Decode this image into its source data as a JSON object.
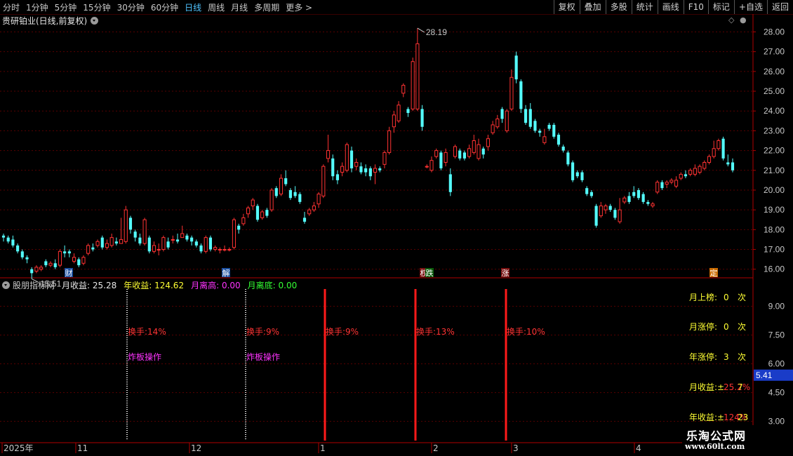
{
  "toolbar": {
    "periods": [
      "分时",
      "1分钟",
      "5分钟",
      "15分钟",
      "30分钟",
      "60分钟",
      "日线",
      "周线",
      "月线",
      "多周期",
      "更多 >"
    ],
    "active_period": "日线",
    "buttons": [
      "复权",
      "叠加",
      "多股",
      "统计",
      "画线",
      "F10",
      "标记",
      "+自选",
      "返回"
    ]
  },
  "chart_header": {
    "title": "贵研铂业(日线,前复权)"
  },
  "price_axis": {
    "labels": [
      "28.00",
      "27.00",
      "26.00",
      "25.00",
      "24.00",
      "23.00",
      "22.00",
      "21.00",
      "20.00",
      "19.00",
      "18.00",
      "17.00",
      "16.00"
    ],
    "min": 15.6,
    "max": 28.3
  },
  "annotations": {
    "high": "28.19",
    "low": "15.51"
  },
  "event_markers": [
    {
      "label": "财",
      "bg": "#1a4fa0",
      "fg": "#ffffff"
    },
    {
      "label": "解",
      "bg": "#1a4fa0",
      "fg": "#ffffff"
    },
    {
      "label": "权",
      "bg": "#7a1010",
      "fg": "#ffffff"
    },
    {
      "label": "跌",
      "bg": "#0a5a0a",
      "fg": "#ffffff"
    },
    {
      "label": "涨",
      "bg": "#7a1010",
      "fg": "#ffffff"
    },
    {
      "label": "定",
      "bg": "#c86a00",
      "fg": "#ffffff"
    }
  ],
  "indicator": {
    "name": "股朋指标网",
    "values": [
      {
        "label": "月收益: 25.28",
        "color": "#e8e8e8"
      },
      {
        "label": "年收益: 124.62",
        "color": "#ffff33"
      },
      {
        "label": "月离高: 0.00",
        "color": "#ff33ff"
      },
      {
        "label": "月离底: 0.00",
        "color": "#33ff33"
      }
    ],
    "axis_labels": [
      "9.00",
      "7.50",
      "6.00",
      "4.50",
      "3.00"
    ],
    "current_value": "5.41",
    "vlines": [
      {
        "type": "dotted",
        "texts": [
          {
            "t": "换手:14%",
            "c": "#ff3333"
          },
          {
            "t": "炸板操作",
            "c": "#ff33ff"
          }
        ]
      },
      {
        "type": "dotted",
        "texts": [
          {
            "t": "换手:9%",
            "c": "#ff3333"
          },
          {
            "t": "炸板操作",
            "c": "#ff33ff"
          }
        ]
      },
      {
        "type": "solid",
        "texts": [
          {
            "t": "换手:9%",
            "c": "#ff3333"
          }
        ]
      },
      {
        "type": "solid",
        "texts": [
          {
            "t": "换手:13%",
            "c": "#ff3333"
          }
        ]
      },
      {
        "type": "solid",
        "texts": [
          {
            "t": "换手:10%",
            "c": "#ff3333"
          }
        ]
      }
    ],
    "stats": [
      {
        "label": "月上榜:",
        "value": "0",
        "unit": "次"
      },
      {
        "label": "月涨停:",
        "value": "0",
        "unit": "次"
      },
      {
        "label": "年涨停:",
        "value": "3",
        "unit": "次"
      },
      {
        "label": "月收益:±",
        "value": "25.2%",
        "unit": "7"
      },
      {
        "label": "年收益:±",
        "value": "124%",
        "unit": "23"
      }
    ]
  },
  "date_axis": [
    "2025年",
    "11",
    "12",
    "1",
    "2",
    "3",
    "4"
  ],
  "watermark": {
    "line1": "乐淘公式网",
    "line2": "www.60lt.com"
  },
  "colors": {
    "up": "#ff3232",
    "down": "#54fcfc",
    "grid": "#5a0000",
    "axis": "#b00000"
  },
  "chart_data": {
    "type": "candlestick",
    "candles": [
      [
        17.7,
        17.6,
        17.8,
        17.4
      ],
      [
        17.6,
        17.4,
        17.7,
        17.3
      ],
      [
        17.5,
        17.2,
        17.7,
        17.1
      ],
      [
        17.2,
        16.9,
        17.3,
        16.8
      ],
      [
        16.9,
        16.6,
        17.0,
        16.5
      ],
      [
        16.6,
        16.5,
        16.7,
        16.3
      ],
      [
        16.0,
        15.8,
        16.1,
        15.51
      ],
      [
        15.9,
        16.1,
        16.2,
        15.8
      ],
      [
        16.0,
        16.1,
        16.2,
        15.9
      ],
      [
        16.4,
        16.2,
        16.5,
        16.1
      ],
      [
        16.2,
        16.3,
        16.4,
        16.1
      ],
      [
        16.3,
        16.1,
        16.5,
        16.0
      ],
      [
        16.2,
        16.9,
        17.0,
        16.1
      ],
      [
        16.9,
        16.8,
        17.2,
        16.6
      ],
      [
        16.9,
        16.8,
        17.0,
        16.6
      ],
      [
        16.4,
        16.6,
        16.8,
        16.3
      ],
      [
        16.5,
        16.2,
        16.6,
        16.1
      ],
      [
        16.3,
        16.6,
        16.7,
        16.2
      ],
      [
        16.8,
        17.2,
        17.3,
        16.7
      ],
      [
        17.1,
        17.0,
        17.3,
        16.9
      ],
      [
        17.2,
        17.4,
        17.5,
        17.1
      ],
      [
        17.6,
        17.1,
        17.7,
        17.0
      ],
      [
        17.1,
        17.3,
        17.5,
        17.0
      ],
      [
        17.2,
        17.6,
        17.8,
        17.1
      ],
      [
        17.4,
        17.3,
        17.6,
        17.2
      ],
      [
        17.3,
        17.5,
        18.6,
        17.3
      ],
      [
        17.4,
        19.0,
        19.2,
        17.3
      ],
      [
        18.6,
        18.0,
        18.7,
        17.8
      ],
      [
        17.9,
        17.6,
        18.0,
        17.4
      ],
      [
        17.6,
        17.3,
        17.8,
        17.2
      ],
      [
        17.3,
        18.5,
        18.6,
        17.2
      ],
      [
        17.6,
        16.9,
        17.7,
        16.8
      ],
      [
        16.9,
        17.2,
        17.4,
        16.8
      ],
      [
        17.0,
        17.0,
        17.3,
        16.7
      ],
      [
        17.0,
        17.6,
        17.7,
        16.9
      ],
      [
        17.4,
        17.1,
        17.6,
        17.0
      ],
      [
        17.5,
        17.5,
        17.7,
        17.3
      ],
      [
        17.5,
        17.4,
        17.8,
        17.3
      ],
      [
        17.6,
        17.8,
        18.2,
        17.6
      ],
      [
        17.7,
        17.5,
        17.8,
        17.4
      ],
      [
        17.6,
        17.4,
        17.7,
        17.2
      ],
      [
        17.4,
        17.2,
        17.5,
        17.1
      ],
      [
        17.2,
        16.9,
        17.3,
        16.8
      ],
      [
        16.9,
        17.6,
        17.7,
        16.8
      ],
      [
        17.6,
        17.0,
        17.7,
        16.9
      ],
      [
        17.0,
        17.1,
        17.2,
        16.9
      ],
      [
        17.0,
        17.0,
        17.1,
        16.8
      ],
      [
        17.0,
        17.0,
        17.2,
        16.9
      ],
      [
        17.0,
        17.0,
        17.1,
        16.9
      ],
      [
        17.1,
        18.5,
        18.6,
        17.0
      ],
      [
        18.2,
        18.0,
        18.3,
        17.8
      ],
      [
        18.3,
        18.6,
        18.8,
        18.2
      ],
      [
        18.8,
        19.1,
        19.2,
        18.6
      ],
      [
        19.2,
        19.5,
        19.6,
        19.0
      ],
      [
        19.2,
        18.5,
        19.3,
        18.4
      ],
      [
        18.6,
        18.9,
        19.0,
        18.5
      ],
      [
        19.0,
        18.7,
        19.1,
        18.6
      ],
      [
        19.0,
        20.0,
        20.1,
        18.9
      ],
      [
        20.1,
        19.7,
        20.2,
        19.6
      ],
      [
        19.8,
        20.6,
        20.8,
        19.7
      ],
      [
        20.6,
        20.3,
        21.0,
        20.2
      ],
      [
        20.0,
        19.6,
        20.1,
        19.5
      ],
      [
        19.9,
        19.7,
        20.2,
        19.6
      ],
      [
        19.8,
        19.4,
        19.9,
        19.3
      ],
      [
        18.6,
        18.4,
        18.9,
        18.3
      ],
      [
        18.8,
        19.0,
        19.1,
        18.7
      ],
      [
        19.0,
        19.2,
        19.4,
        18.9
      ],
      [
        19.3,
        19.8,
        19.9,
        19.1
      ],
      [
        19.7,
        21.2,
        21.3,
        19.6
      ],
      [
        21.6,
        22.0,
        22.8,
        21.4
      ],
      [
        21.6,
        20.7,
        21.8,
        20.5
      ],
      [
        20.8,
        20.5,
        21.0,
        20.3
      ],
      [
        20.9,
        21.2,
        21.4,
        20.7
      ],
      [
        21.0,
        22.3,
        22.4,
        20.9
      ],
      [
        22.0,
        21.1,
        22.2,
        20.9
      ],
      [
        21.2,
        21.4,
        21.6,
        21.0
      ],
      [
        21.2,
        20.9,
        21.4,
        20.8
      ],
      [
        21.1,
        20.9,
        21.3,
        20.7
      ],
      [
        21.1,
        20.7,
        21.2,
        20.5
      ],
      [
        20.9,
        21.1,
        21.3,
        20.3
      ],
      [
        21.1,
        21.0,
        21.2,
        20.9
      ],
      [
        21.3,
        21.9,
        22.0,
        21.1
      ],
      [
        21.9,
        23.0,
        23.2,
        21.8
      ],
      [
        23.2,
        23.8,
        24.0,
        22.9
      ],
      [
        23.5,
        24.3,
        24.5,
        23.4
      ],
      [
        24.9,
        25.3,
        25.4,
        24.7
      ],
      [
        24.1,
        23.9,
        24.2,
        23.7
      ],
      [
        24.1,
        26.5,
        26.7,
        24.0
      ],
      [
        24.1,
        27.4,
        28.19,
        24.0
      ],
      [
        24.1,
        23.2,
        24.3,
        23.0
      ],
      [
        21.2,
        21.2,
        21.3,
        21.1
      ],
      [
        21.0,
        21.5,
        21.7,
        20.9
      ],
      [
        21.7,
        22.0,
        22.1,
        21.6
      ],
      [
        21.9,
        21.1,
        22.0,
        21.0
      ],
      [
        21.4,
        21.9,
        22.1,
        21.2
      ],
      [
        20.8,
        19.9,
        21.1,
        19.7
      ],
      [
        21.7,
        22.2,
        22.3,
        21.6
      ],
      [
        22.0,
        21.6,
        22.1,
        21.5
      ],
      [
        21.9,
        21.6,
        22.0,
        21.5
      ],
      [
        21.7,
        22.1,
        22.3,
        21.6
      ],
      [
        21.9,
        22.5,
        22.8,
        21.8
      ],
      [
        21.6,
        22.3,
        22.6,
        21.5
      ],
      [
        22.1,
        21.8,
        22.2,
        21.6
      ],
      [
        22.2,
        22.6,
        22.8,
        22.0
      ],
      [
        22.9,
        23.3,
        23.5,
        22.8
      ],
      [
        23.2,
        23.6,
        23.8,
        23.1
      ],
      [
        24.1,
        23.6,
        24.2,
        23.4
      ],
      [
        23.0,
        24.0,
        24.1,
        22.9
      ],
      [
        24.1,
        25.7,
        26.1,
        24.0
      ],
      [
        26.8,
        25.6,
        27.0,
        25.4
      ],
      [
        25.5,
        24.1,
        25.6,
        23.9
      ],
      [
        24.1,
        23.4,
        24.3,
        23.3
      ],
      [
        24.1,
        23.2,
        24.4,
        23.1
      ],
      [
        23.5,
        23.0,
        23.6,
        22.9
      ],
      [
        23.0,
        22.9,
        23.1,
        22.7
      ],
      [
        22.4,
        22.7,
        23.1,
        22.3
      ],
      [
        23.3,
        23.1,
        23.4,
        23.0
      ],
      [
        23.3,
        22.7,
        23.4,
        22.6
      ],
      [
        22.8,
        22.3,
        22.9,
        22.2
      ],
      [
        22.2,
        22.0,
        22.3,
        21.9
      ],
      [
        21.9,
        21.3,
        22.0,
        21.2
      ],
      [
        21.4,
        20.5,
        21.5,
        20.4
      ],
      [
        20.9,
        20.7,
        21.0,
        20.6
      ],
      [
        20.9,
        20.5,
        21.0,
        20.4
      ],
      [
        20.1,
        19.8,
        20.2,
        19.7
      ],
      [
        19.9,
        19.7,
        20.0,
        19.6
      ],
      [
        19.2,
        18.2,
        19.3,
        18.1
      ],
      [
        18.7,
        19.2,
        19.4,
        18.6
      ],
      [
        19.0,
        19.2,
        19.3,
        18.8
      ],
      [
        19.2,
        19.0,
        19.3,
        18.9
      ],
      [
        19.0,
        18.6,
        19.1,
        18.5
      ],
      [
        18.4,
        19.0,
        19.6,
        18.3
      ],
      [
        19.4,
        19.6,
        19.7,
        19.3
      ],
      [
        19.7,
        19.4,
        19.9,
        19.3
      ],
      [
        19.9,
        19.7,
        20.2,
        19.6
      ],
      [
        20.0,
        19.6,
        20.1,
        19.5
      ],
      [
        19.8,
        19.4,
        19.9,
        19.3
      ],
      [
        19.4,
        19.3,
        19.5,
        19.2
      ],
      [
        19.2,
        19.3,
        19.4,
        19.1
      ],
      [
        19.9,
        20.4,
        20.5,
        19.8
      ],
      [
        20.4,
        20.1,
        20.5,
        20.0
      ],
      [
        20.3,
        20.4,
        20.5,
        20.1
      ],
      [
        20.4,
        20.5,
        20.6,
        20.3
      ],
      [
        20.2,
        20.5,
        20.7,
        20.1
      ],
      [
        20.6,
        20.8,
        20.9,
        20.5
      ],
      [
        20.8,
        20.7,
        21.0,
        20.6
      ],
      [
        20.8,
        21.0,
        21.1,
        20.7
      ],
      [
        20.8,
        21.1,
        21.3,
        20.7
      ],
      [
        20.9,
        21.2,
        21.3,
        20.8
      ],
      [
        21.1,
        21.4,
        21.5,
        21.0
      ],
      [
        21.4,
        21.7,
        21.8,
        21.3
      ],
      [
        21.7,
        22.1,
        22.5,
        21.6
      ],
      [
        22.1,
        22.5,
        22.6,
        22.0
      ],
      [
        22.6,
        21.6,
        22.7,
        21.5
      ],
      [
        21.4,
        21.3,
        21.8,
        21.2
      ],
      [
        21.4,
        21.0,
        21.6,
        20.9
      ]
    ]
  }
}
